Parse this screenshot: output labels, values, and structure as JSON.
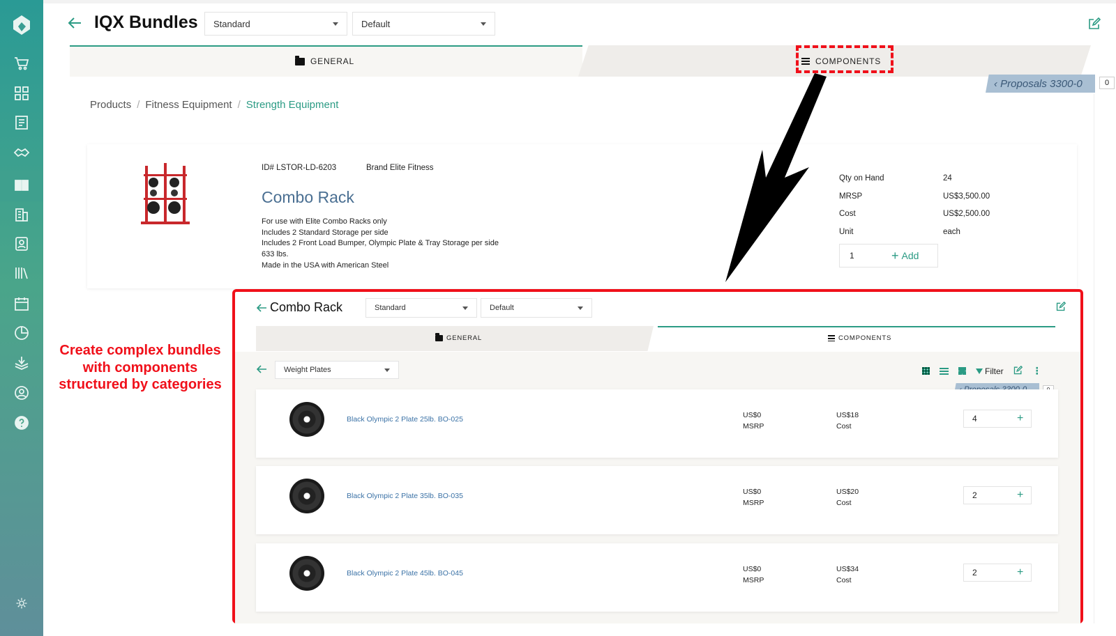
{
  "header": {
    "title": "IQX Bundles",
    "select1": "Standard",
    "select2": "Default"
  },
  "tabs": {
    "general": "GENERAL",
    "components": "COMPONENTS"
  },
  "proposal": {
    "label": "Proposals 3300-0",
    "count": "0"
  },
  "breadcrumb": {
    "items": [
      "Products",
      "Fitness Equipment"
    ],
    "current": "Strength Equipment",
    "sep": "/"
  },
  "product": {
    "id": "ID# LSTOR-LD-6203",
    "brand": "Brand Elite Fitness",
    "name": "Combo Rack",
    "desc": [
      "For use with Elite Combo Racks only",
      "Includes 2 Standard Storage per side",
      "Includes 2 Front Load Bumper, Olympic Plate & Tray Storage per side",
      "633 lbs.",
      "Made in the USA with American Steel"
    ],
    "specs": [
      {
        "k": "Qty on Hand",
        "v": "24"
      },
      {
        "k": "MRSP",
        "v": "US$3,500.00"
      },
      {
        "k": "Cost",
        "v": "US$2,500.00"
      },
      {
        "k": "Unit",
        "v": "each"
      }
    ],
    "qty": "1",
    "add_label": "Add"
  },
  "annotation": [
    "Create complex bundles",
    "with components",
    "structured by categories"
  ],
  "inset": {
    "title": "Combo Rack",
    "select1": "Standard",
    "select2": "Default",
    "tab_general": "GENERAL",
    "tab_components": "COMPONENTS",
    "category": "Weight Plates",
    "filter_label": "Filter",
    "proposal": "Proposals 3300-0",
    "proposal_count": "0",
    "items": [
      {
        "name": "Black Olympic 2 Plate 25lb. BO-025",
        "msrp_val": "US$0",
        "msrp_lbl": "MSRP",
        "cost_val": "US$18",
        "cost_lbl": "Cost",
        "qty": "4"
      },
      {
        "name": "Black Olympic 2 Plate 35lb. BO-035",
        "msrp_val": "US$0",
        "msrp_lbl": "MSRP",
        "cost_val": "US$20",
        "cost_lbl": "Cost",
        "qty": "2"
      },
      {
        "name": "Black Olympic 2 Plate 45lb. BO-045",
        "msrp_val": "US$0",
        "msrp_lbl": "MSRP",
        "cost_val": "US$34",
        "cost_lbl": "Cost",
        "qty": "2"
      }
    ]
  },
  "colors": {
    "accent": "#2b9b84",
    "highlight": "#f0101a",
    "link": "#3b72a6"
  }
}
